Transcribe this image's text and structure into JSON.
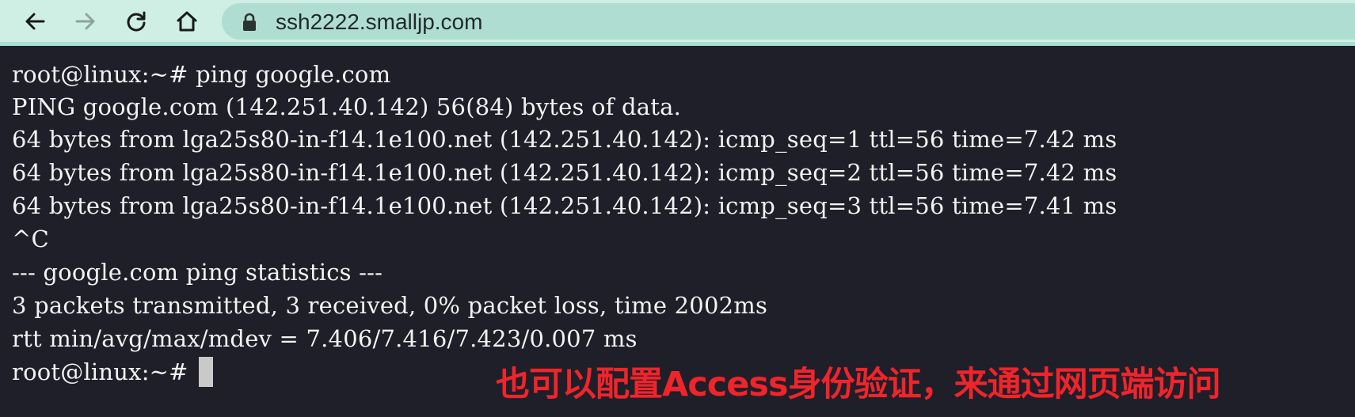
{
  "browser": {
    "url": "ssh2222.smalljp.com",
    "icons": {
      "back": "back-arrow-icon",
      "forward": "forward-arrow-icon",
      "reload": "reload-icon",
      "home": "home-icon",
      "lock": "lock-icon"
    },
    "colors": {
      "toolbar": "#cfeee4",
      "omnibox": "#b0ddd2"
    }
  },
  "terminal": {
    "background": "#1e1f29",
    "foreground": "#f2f2f2",
    "lines": [
      "root@linux:~# ping google.com",
      "PING google.com (142.251.40.142) 56(84) bytes of data.",
      "64 bytes from lga25s80-in-f14.1e100.net (142.251.40.142): icmp_seq=1 ttl=56 time=7.42 ms",
      "64 bytes from lga25s80-in-f14.1e100.net (142.251.40.142): icmp_seq=2 ttl=56 time=7.42 ms",
      "64 bytes from lga25s80-in-f14.1e100.net (142.251.40.142): icmp_seq=3 ttl=56 time=7.41 ms",
      "^C",
      "--- google.com ping statistics ---",
      "3 packets transmitted, 3 received, 0% packet loss, time 2002ms",
      "rtt min/avg/max/mdev = 7.406/7.416/7.423/0.007 ms"
    ],
    "prompt": "root@linux:~# "
  },
  "annotation": {
    "text": "也可以配置Access身份验证，来通过网页端访问",
    "color": "#f0242b"
  }
}
